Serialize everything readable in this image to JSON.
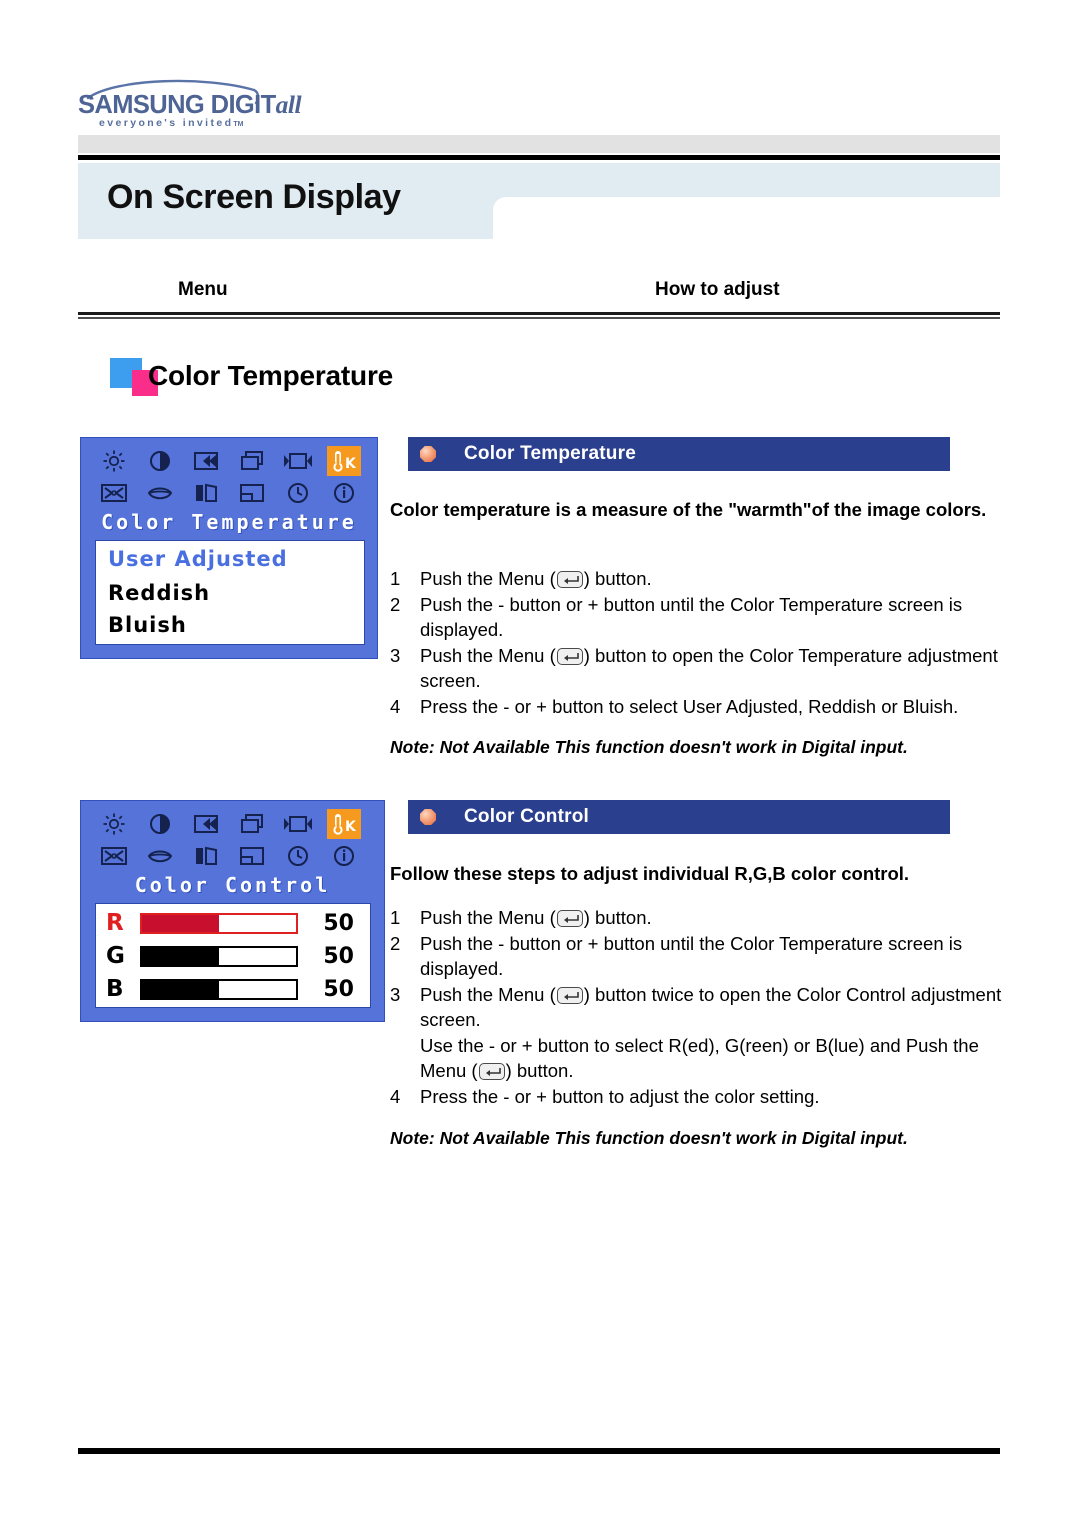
{
  "brand": {
    "wordmark_main": "SAMSUNG DIGIT",
    "wordmark_italic": "all",
    "tagline": "everyone's invited",
    "tagline_tm": "TM"
  },
  "header": {
    "page_title": "On Screen Display",
    "columns": {
      "menu": "Menu",
      "how_to_adjust": "How to adjust"
    }
  },
  "section": {
    "heading": "Color Temperature",
    "square_blue": "#3d9ef0",
    "square_pink": "#fa2d8a"
  },
  "osd_icons": {
    "row1": [
      "brightness-icon",
      "contrast-icon",
      "h-position-icon",
      "v-position-icon",
      "image-size-icon",
      "color-temperature-icon"
    ],
    "row2": [
      "image-lock-icon",
      "language-icon",
      "sharpness-icon",
      "osd-position-icon",
      "timer-icon",
      "information-icon"
    ],
    "highlight_color": "#f59a1e",
    "highlight_label": "K"
  },
  "osd_panel_1": {
    "title": "Color Temperature",
    "options": [
      {
        "label": "User Adjusted",
        "selected": true
      },
      {
        "label": "Reddish",
        "selected": false
      },
      {
        "label": "Bluish",
        "selected": false
      }
    ]
  },
  "osd_panel_2": {
    "title": "Color Control",
    "sliders": [
      {
        "label": "R",
        "value": "50",
        "percent": 50,
        "accent": "#c8102e",
        "selected": true
      },
      {
        "label": "G",
        "value": "50",
        "percent": 50,
        "accent": "#000000",
        "selected": false
      },
      {
        "label": "B",
        "value": "50",
        "percent": 50,
        "accent": "#000000",
        "selected": false
      }
    ]
  },
  "block_1": {
    "caption": "Color Temperature",
    "lead": "Color temperature is a measure of the \"warmth\"of the image colors.",
    "steps": [
      {
        "num": "1",
        "pre": "Push the Menu (",
        "post": ") button.",
        "has_button": true
      },
      {
        "num": "2",
        "pre": "Push the - button or + button until the Color Temperature screen is displayed.",
        "post": "",
        "has_button": false
      },
      {
        "num": "3",
        "pre": "Push the Menu (",
        "post": ") button to open the Color Temperature adjustment screen.",
        "has_button": true
      },
      {
        "num": "4",
        "pre": "Press the - or + button to select User Adjusted, Reddish or Bluish.",
        "post": "",
        "has_button": false
      }
    ],
    "note": "Note: Not Available  This function doesn't work in Digital input."
  },
  "block_2": {
    "caption": "Color Control",
    "lead": "Follow these steps to adjust individual R,G,B color control.",
    "steps": [
      {
        "num": "1",
        "pre": "Push the Menu (",
        "post": ") button.",
        "has_button": true
      },
      {
        "num": "2",
        "pre": "Push the - button or + button until the Color Temperature screen is displayed.",
        "post": "",
        "has_button": false
      },
      {
        "num": "3",
        "pre": "Push the Menu (",
        "post": ") button twice to open the Color Control adjustment screen.",
        "has_button": true
      }
    ],
    "step3_extra": {
      "pre": "Use the - or + button to select R(ed), G(reen) or B(lue) and Push the Menu (",
      "post": ") button."
    },
    "step4": {
      "num": "4",
      "text": "Press the - or + button to adjust the color setting."
    },
    "note": "Note: Not Available  This function doesn't work in Digital input."
  }
}
